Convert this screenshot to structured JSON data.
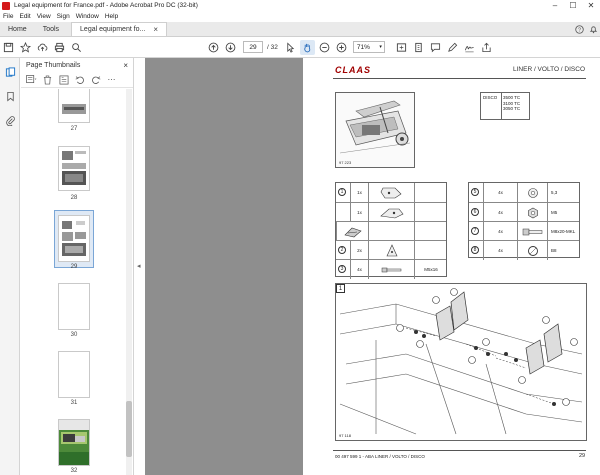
{
  "window": {
    "title": "Legal equipment for France.pdf - Adobe Acrobat Pro DC (32-bit)",
    "controls": [
      "–",
      "☐",
      "✕"
    ]
  },
  "menu": [
    "File",
    "Edit",
    "View",
    "Sign",
    "Window",
    "Help"
  ],
  "tabs": {
    "home": "Home",
    "tools": "Tools",
    "document": "Legal equipment fo...",
    "close": "×"
  },
  "toolbar": {
    "current_page": "29",
    "total_pages": "/ 32",
    "zoom": "71%"
  },
  "thumbnails": {
    "title": "Page Thumbnails",
    "close": "×",
    "pages": [
      {
        "label": "27"
      },
      {
        "label": "28"
      },
      {
        "label": "29",
        "selected": true
      },
      {
        "label": "30"
      },
      {
        "label": "31"
      },
      {
        "label": "32"
      }
    ]
  },
  "pdf_page": {
    "brand": "CLAAS",
    "header_title": "LINER / VOLTO / DISCO",
    "info_figure": "97 223",
    "models": {
      "series": "DISCO",
      "items": [
        "3500 TC",
        "3100 TC",
        "3050 TC"
      ]
    },
    "parts_left": [
      {
        "num": "1",
        "qty": "1x",
        "spec": ""
      },
      {
        "num": "",
        "qty": "1x",
        "spec": ""
      },
      {
        "num": "",
        "qty": "",
        "spec": ""
      },
      {
        "num": "2",
        "qty": "2x",
        "spec": ""
      },
      {
        "num": "3",
        "qty": "4x",
        "spec": "M5x16"
      }
    ],
    "parts_right": [
      {
        "num": "5",
        "qty": "4x",
        "spec": "5,3"
      },
      {
        "num": "6",
        "qty": "4x",
        "spec": "M5"
      },
      {
        "num": "7",
        "qty": "4x",
        "spec": "M8x20-MKL"
      },
      {
        "num": "8",
        "qty": "4x",
        "spec": "B8"
      }
    ],
    "step": "1",
    "assembly_figure": "97 118",
    "footer_left": "00 497 599 1 - ABA LINER / VOLTO / DISCO",
    "page_number": "29"
  }
}
